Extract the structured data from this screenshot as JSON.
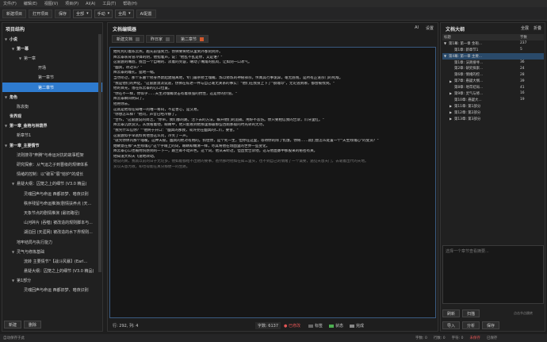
{
  "menu": [
    "文件(F)",
    "编辑(E)",
    "视图(V)",
    "项目(P)",
    "AI(A)",
    "工具(T)",
    "帮助(H)"
  ],
  "toolbar": {
    "new_project": "新建项目",
    "open_project": "打开项目",
    "save": "保存",
    "all": "全部",
    "mode": "手动",
    "scope": "全局",
    "ai_config": "AI配置"
  },
  "left": {
    "title": "项目结构",
    "nodes": [
      {
        "label": "小说",
        "indent": 0,
        "bold": true,
        "tri": "▼",
        "sel": false
      },
      {
        "label": "第一幕",
        "indent": 1,
        "bold": true,
        "tri": "▼",
        "sel": false
      },
      {
        "label": "第一章",
        "indent": 2,
        "bold": false,
        "tri": "▼",
        "sel": false
      },
      {
        "label": "开场",
        "indent": 4,
        "bold": false,
        "tri": "",
        "sel": false
      },
      {
        "label": "第一章节",
        "indent": 4,
        "bold": false,
        "tri": "",
        "sel": false
      },
      {
        "label": "第二章节",
        "indent": 4,
        "bold": false,
        "tri": "",
        "sel": true
      },
      {
        "label": "角色",
        "indent": 0,
        "bold": true,
        "tri": "▼",
        "sel": false
      },
      {
        "label": "陈袁衡",
        "indent": 1,
        "bold": false,
        "tri": "",
        "sel": false
      },
      {
        "label": "世界观",
        "indent": 0,
        "bold": true,
        "tri": "",
        "sel": false
      },
      {
        "label": "第一章_金袍与林荫界",
        "indent": 0,
        "bold": true,
        "tri": "▼",
        "sel": false
      },
      {
        "label": "新章节1",
        "indent": 1,
        "bold": false,
        "tri": "",
        "sel": false
      },
      {
        "label": "第一章_主要情节",
        "indent": 0,
        "bold": true,
        "tri": "▼",
        "sel": false
      },
      {
        "label": "法则搜寻\"奔腾\"与命运对抗的故事框架",
        "indent": 1,
        "bold": false,
        "tri": "",
        "sel": false
      },
      {
        "label": "研究探索：从气运之子到晋级的规律体系",
        "indent": 1,
        "bold": false,
        "tri": "",
        "sel": false
      },
      {
        "label": "情绪的控制：以\"破军\"展\"熔炉\"的成长",
        "indent": 1,
        "bold": false,
        "tri": "",
        "sel": false
      },
      {
        "label": "悬疑大纲：囚笼之上的细节 (V3.0 精品)",
        "indent": 1,
        "bold": false,
        "tri": "▼",
        "sel": false
      },
      {
        "label": "灵魂回声与命运 西都旧梦、暗夜识别",
        "indent": 2,
        "bold": false,
        "tri": "",
        "sel": false
      },
      {
        "label": "秩序残留与命运推演(剧情扶养点 (天...",
        "indent": 2,
        "bold": false,
        "tri": "",
        "sel": false
      },
      {
        "label": "天象节点的剧情推演 (最初路径)",
        "indent": 2,
        "bold": false,
        "tri": "",
        "sel": false
      },
      {
        "label": "山河碎片 (吞噬) 被改造的规则脚本与...",
        "indent": 2,
        "bold": false,
        "tri": "",
        "sel": false
      },
      {
        "label": "湖泊回 (天涯网) 被改造的水下界规则...",
        "indent": 2,
        "bold": false,
        "tri": "",
        "sel": false
      },
      {
        "label": "地牢结局与执行能力",
        "indent": 1,
        "bold": false,
        "tri": "",
        "sel": false
      },
      {
        "label": "灵气与修炼基础",
        "indent": 1,
        "bold": false,
        "tri": "▼",
        "sel": false
      },
      {
        "label": "流转 主要情节\"【战斗风暴】(Earl...",
        "indent": 2,
        "bold": false,
        "tri": "",
        "sel": false
      },
      {
        "label": "悬疑大纲：囚笼之上的细节 (V3.0 精品)",
        "indent": 2,
        "bold": false,
        "tri": "",
        "sel": false
      },
      {
        "label": "第1部分",
        "indent": 1,
        "bold": false,
        "tri": "▼",
        "sel": false
      },
      {
        "label": "灵魂回声与命运 西都旧梦、暗夜识别",
        "indent": 2,
        "bold": false,
        "tri": "",
        "sel": false
      }
    ],
    "new_btn": "新建",
    "delete_btn": "删除"
  },
  "editor": {
    "title": "文档编辑器",
    "ai_label": "AI",
    "settings_label": "设置",
    "tabs": [
      "新建文档",
      "昨日家",
      "第二章节"
    ],
    "lines": [
      "她死死盯着陈云燕，越先前强到力，仿佛要将他从里到外都刻到外。",
      "降云泰咳背冒冷锋的阴，他指着声，说：\"他乱不乱是你，又是谁？\"",
      "这雷霆的嘴唇，拢出一个自嘲的、淡着的笑容，嘲动了嘴角的肌肉，让如刻一口冰气。",
      "\"幽冥，听过么？\"",
      "降云泰的瞳孔，猛地一缩。",
      "当然听过，那个东墓个修身界默起建陆离地，专门最杀修士魂魄、炼以修炼的神秘邪宗。传闻其行事诡异，毫无底线，是所有正道宗门的死敌。",
      "\"我是他们的弃徒。\"这雷霆漠淡说道，仿佛在陈述一件与自己毫无关系的事实：\"他们在我身上下了\"锁魂印\"，无论逃到哪，都会被找到。\"",
      "他的目光，落在陈云泰的心口位置。",
      "\"你在不一样，你似乎……天生对魂魄攻击有着很强的抗性，这是你的价值。\"",
      "降云泰瞬间明白了。",
      "他用你去，",
      "这就是他现在知唯一的唯一筹码，不是善心，是交易。",
      "\"你想怎么样？\"他问，声音已经冷静了。",
      "\"合作，\"这雷霆说的简洁，\"你带，我们都的路。活下去的方法，躲开他们的追捕，用好不悲伤。你只要相信我的告诉，爪牙里红。\"",
      "降云泰沉默良久，从我看着他，眼睛中，他只能看到他那里那最那些古跑那般的时光转的无尽。",
      "\"我凭什么信你？\"\"他终于开口：\"幽冥的那我，或许完在幽冥的仁爪，要害。\"",
      "这雷霆似乎早就料到他会这么问，冷笑了一声。",
      "\"就凭你体内那个魂魄，这种天赋，幽冥的绝对有用的。抓住你，是个死一生，但你在这里，等待你的除了饥饿，你将……就们会怎么处置一个\"天生残魂心\"的变员？\"",
      "她故意在那\"天生残魂心\"这个字眼上的词，眼睛却做清一样，尽其将他在场面里的世界一些变化。",
      "降云泰心口也被附院感到的一下一，跟兰却不动声色，这个词，他从未听过，但直觉告诉他，这与他血脉中那股来的秘密有关。",
      "他知道大和天飞速地转动。",
      "她说的真，我就以前的日子无论多，他如能都给不出他的要事，爸然那时他如在知三里头，也不到自己的情绪了一个诚要，遇见天恩天门，去靠着出代的天地。",
      "赏以天恩为救，却也得能在真分那便一的生路。"
    ],
    "cursor": "行: 292, 列: 4",
    "word_count": "字数: 6137",
    "modified": "已修改",
    "tag1": "标签",
    "tag2": "状态",
    "tag3": "完成"
  },
  "outline": {
    "title": "文档大纲",
    "all": "全展",
    "collapse": "折叠",
    "col_title": "标题",
    "col_count": "字数",
    "rows": [
      {
        "tri": "▼",
        "label": "第1幕: 第一章 金袍...",
        "count": "237",
        "indent": 0,
        "sel": false
      },
      {
        "tri": "",
        "label": "第1章: 新章节1",
        "count": "5",
        "indent": 1,
        "sel": false
      },
      {
        "tri": "▼",
        "label": "第4幕: 第一章 主要...",
        "count": "",
        "indent": 0,
        "sel": true
      },
      {
        "tri": "",
        "label": "第1章: 法则搜寻...",
        "count": "36",
        "indent": 1,
        "sel": false
      },
      {
        "tri": "",
        "label": "第2章: 研究探索...",
        "count": "24",
        "indent": 1,
        "sel": false
      },
      {
        "tri": "",
        "label": "第6章: 情绪的控...",
        "count": "28",
        "indent": 1,
        "sel": false
      },
      {
        "tri": "▶",
        "label": "第7章: 悬疑大纲...",
        "count": "39",
        "indent": 1,
        "sel": false
      },
      {
        "tri": "",
        "label": "第8章: 地牢结局...",
        "count": "41",
        "indent": 1,
        "sel": false
      },
      {
        "tri": "▶",
        "label": "第9章: 灵气与修...",
        "count": "16",
        "indent": 1,
        "sel": false
      },
      {
        "tri": "",
        "label": "第10章: 悬疑大...",
        "count": "19",
        "indent": 1,
        "sel": false
      },
      {
        "tri": "▶",
        "label": "第11章: 第1部分",
        "count": "",
        "indent": 1,
        "sel": false
      },
      {
        "tri": "▶",
        "label": "第12章: 第2部分",
        "count": "",
        "indent": 1,
        "sel": false
      },
      {
        "tri": "▶",
        "label": "第13章: 第3部分",
        "count": "",
        "indent": 1,
        "sel": false
      }
    ],
    "preview_placeholder": "选择一个章节查看摘要...",
    "refresh": "刷新",
    "scan": "扫描",
    "import": "导入",
    "analyze": "分析",
    "save_label": "保存",
    "hint": "点击节点跳转"
  },
  "statusbar": {
    "left": "自动保存于此",
    "s1": "字数: 0",
    "s2": "行数: 0",
    "s3": "字符: 0",
    "s4": "未保存",
    "s5": "已保存"
  }
}
